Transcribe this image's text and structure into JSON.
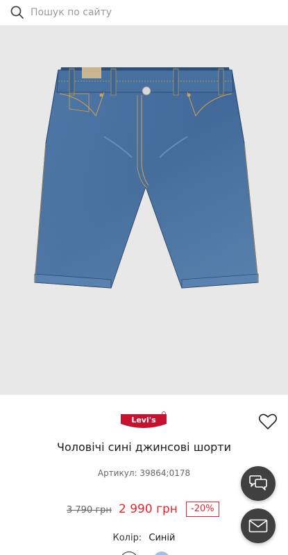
{
  "search": {
    "placeholder": "Пошук по сайту",
    "icon": "search-icon"
  },
  "product": {
    "image_alt": "Чоловічі сині джинсові шорти",
    "brand": "Levi's",
    "title": "Чоловічі сині джинсові шорти",
    "sku_label": "Артикул:",
    "sku_value": "39864;0178",
    "old_price": "3 790 грн",
    "new_price": "2 990 грн",
    "discount": "-20%",
    "color_label": "Колір:",
    "color_value": "Синій"
  },
  "actions": {
    "wishlist_icon": "heart-outline-icon",
    "chat_icon": "chat-bubbles-icon",
    "mail_icon": "envelope-icon"
  },
  "colors": {
    "accent_red": "#e4242d",
    "fab_bg": "#404040",
    "image_bg": "#e8e8e8"
  }
}
